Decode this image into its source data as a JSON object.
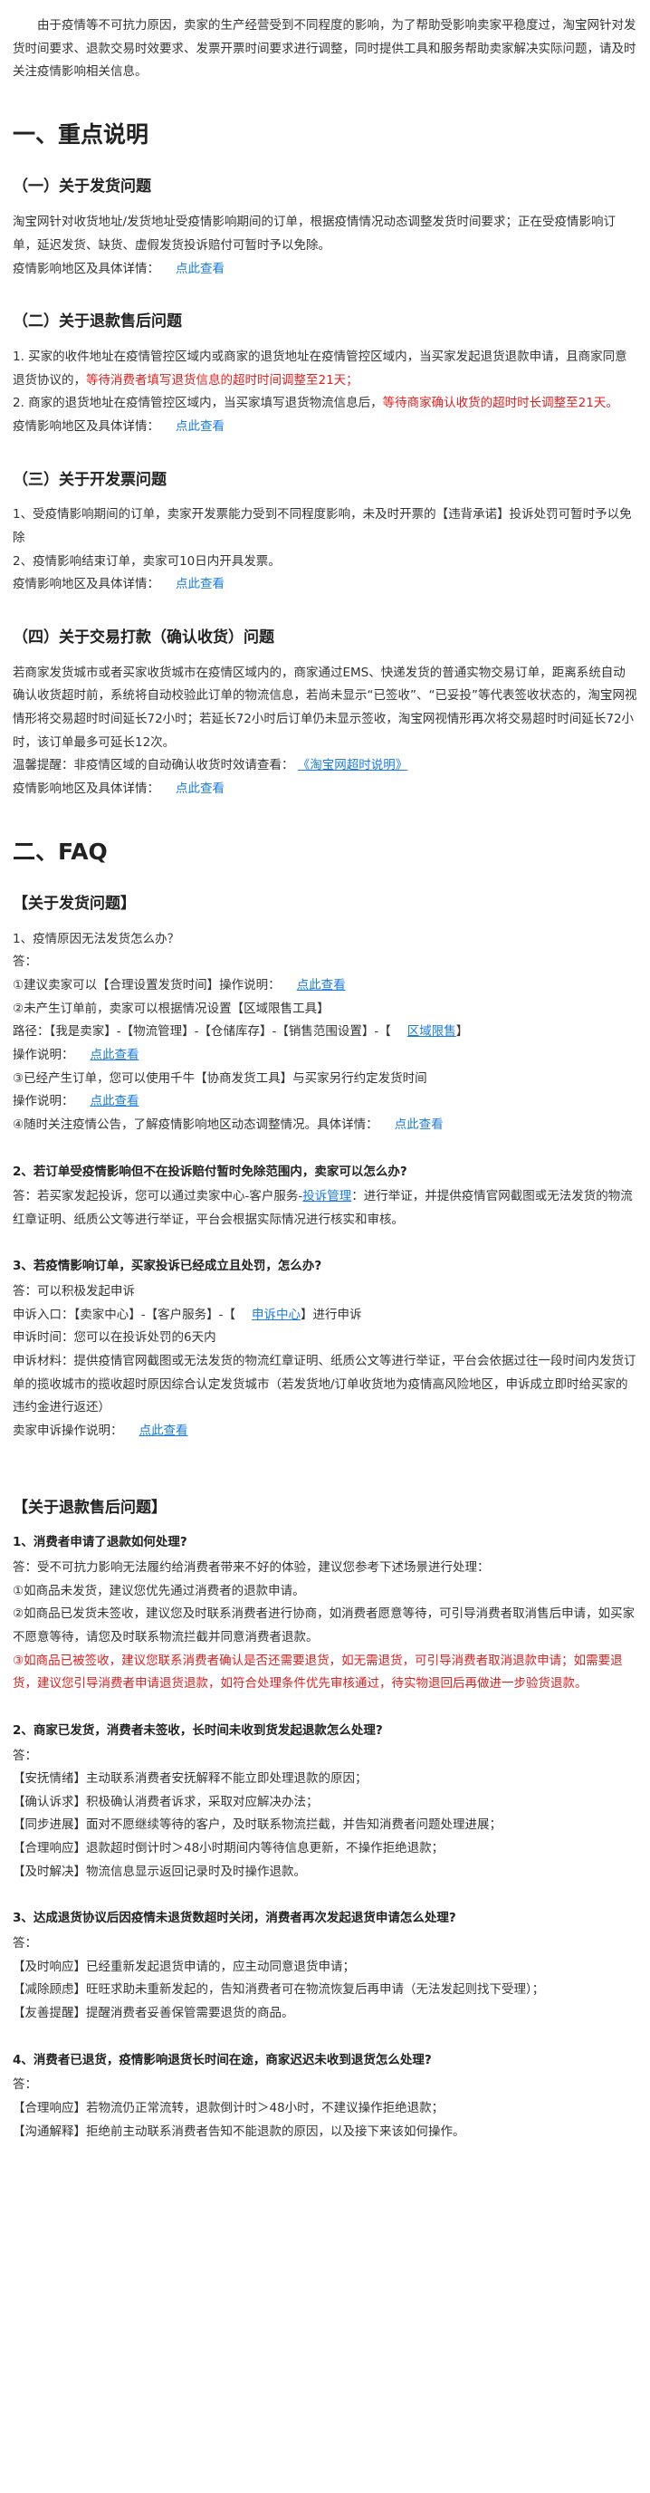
{
  "intro": "由于疫情等不可抗力原因，卖家的生产经营受到不同程度的影响，为了帮助受影响卖家平稳度过，淘宝网针对发货时间要求、退款交易时效要求、发票开票时间要求进行调整，同时提供工具和服务帮助卖家解决实际问题，请及时关注疫情影响相关信息。",
  "section1": {
    "title": "一、重点说明",
    "shipping": {
      "title": "（一）关于发货问题",
      "body": "淘宝网针对收货地址/发货地址受疫情影响期间的订单，根据疫情情况动态调整发货时间要求；正在受疫情影响订单，延迟发货、缺货、虚假发货投诉赔付可暂时予以免除。",
      "detail_label": "疫情影响地区及具体详情：",
      "link": "点此查看"
    },
    "refund": {
      "title": "（二）关于退款售后问题",
      "item1_pre": "1.    买家的收件地址在疫情管控区域内或商家的退货地址在疫情管控区域内，当买家发起退货退款申请，且商家同意退货协议的，",
      "item1_red": "等待消费者填写退货信息的超时时间调整至21天；",
      "item2_pre": "2.    商家的退货地址在疫情管控区域内，当买家填写退货物流信息后，",
      "item2_red": "等待商家确认收货的超时时长调整至21天。",
      "detail_label": "疫情影响地区及具体详情：",
      "link": "点此查看"
    },
    "invoice": {
      "title": "（三）关于开发票问题",
      "item1": "1、受疫情影响期间的订单，卖家开发票能力受到不同程度影响，未及时开票的【违背承诺】投诉处罚可暂时予以免除",
      "item2": "2、疫情影响结束订单，卖家可10日内开具发票。",
      "detail_label": "疫情影响地区及具体详情：",
      "link": "点此查看"
    },
    "payment": {
      "title": "（四）关于交易打款（确认收货）问题",
      "body": "若商家发货城市或者买家收货城市在疫情区域内的，商家通过EMS、快递发货的普通实物交易订单，距离系统自动确认收货超时前，系统将自动校验此订单的物流信息，若尚未显示“已签收”、“已妥投”等代表签收状态的，淘宝网视情形将交易超时时间延长72小时；若延长72小时后订单仍未显示签收，淘宝网视情形再次将交易超时时间延长72小时，该订单最多可延长12次。",
      "tip_label": "温馨提醒：非疫情区域的自动确认收货时效请查看：",
      "tip_link": "《淘宝网超时说明》",
      "detail_label": "疫情影响地区及具体详情：",
      "link": "点此查看"
    }
  },
  "section2": {
    "title": "二、FAQ",
    "group1": {
      "title": "【关于发货问题】",
      "q1": {
        "question": "1、疫情原因无法发货怎么办？",
        "answer_label": "答：",
        "line1_pre": "①建议卖家可以【合理设置发货时间】操作说明：",
        "line1_link": "点此查看",
        "line2": "②未产生订单前，卖家可以根据情况设置【区域限售工具】",
        "line3_pre": "路径：【我是卖家】-【物流管理】-【仓储库存】-【销售范围设置】-【",
        "line3_link": "区域限售",
        "line3_post": "】",
        "line4_pre": "操作说明：",
        "line4_link": "点此查看",
        "line5": "③已经产生订单，您可以使用千牛【协商发货工具】与买家另行约定发货时间",
        "line6_pre": "操作说明：",
        "line6_link": "点此查看",
        "line7_pre": "④随时关注疫情公告，了解疫情影响地区动态调整情况。具体详情：",
        "line7_link": "点此查看"
      },
      "q2": {
        "question": "2、若订单受疫情影响但不在投诉赔付暂时免除范围内，卖家可以怎么办?",
        "answer_pre": "答：若买家发起投诉，您可以通过卖家中心-客户服务-",
        "answer_link": "投诉管理",
        "answer_post": "：进行举证，并提供疫情官网截图或无法发货的物流红章证明、纸质公文等进行举证，平台会根据实际情况进行核实和审核。"
      },
      "q3": {
        "question": "3、若疫情影响订单，买家投诉已经成立且处罚，怎么办?",
        "line1": "答：可以积极发起申诉",
        "line2_pre": "申诉入口：【卖家中心】-【客户服务】-【",
        "line2_link": "申诉中心",
        "line2_post": "】进行申诉",
        "line3": "申诉时间：您可以在投诉处罚的6天内",
        "line4": "申诉材料：提供疫情官网截图或无法发货的物流红章证明、纸质公文等进行举证，平台会依据过往一段时间内发货订单的揽收城市的揽收超时原因综合认定发货城市（若发货地/订单收货地为疫情高风险地区，申诉成立即时给买家的违约金进行返还）",
        "line5_pre": "卖家申诉操作说明：",
        "line5_link": "点此查看"
      }
    },
    "group2": {
      "title": "【关于退款售后问题】",
      "q1": {
        "question": "1、消费者申请了退款如何处理?",
        "answer": "答：受不可抗力影响无法履约给消费者带来不好的体验，建议您参考下述场景进行处理：",
        "line1": "①如商品未发货，建议您优先通过消费者的退款申请。",
        "line2": "②如商品已发货未签收，建议您及时联系消费者进行协商，如消费者愿意等待，可引导消费者取消售后申请，如买家不愿意等待，请您及时联系物流拦截并同意消费者退款。",
        "line3_red": "③如商品已被签收，建议您联系消费者确认是否还需要退货，如无需退货，可引导消费者取消退款申请；如需要退货，建议您引导消费者申请退货退款，如符合处理条件优先审核通过，待实物退回后再做进一步验货退款。"
      },
      "q2": {
        "question": "2、商家已发货，消费者未签收，长时间未收到货发起退款怎么处理?",
        "answer_label": "答：",
        "line1": "【安抚情绪】主动联系消费者安抚解释不能立即处理退款的原因；",
        "line2": "【确认诉求】积极确认消费者诉求，采取对应解决办法；",
        "line3": "【同步进展】面对不愿继续等待的客户，及时联系物流拦截，并告知消费者问题处理进展；",
        "line4": "【合理响应】退款超时倒计时＞48小时期间内等待信息更新，不操作拒绝退款；",
        "line5": "【及时解决】物流信息显示返回记录时及时操作退款。"
      },
      "q3": {
        "question": "3、达成退货协议后因疫情未退货数超时关闭，消费者再次发起退货申请怎么处理?",
        "answer_label": "答：",
        "line1": "【及时响应】已经重新发起退货申请的，应主动同意退货申请；",
        "line2": "【减除顾虑】旺旺求助未重新发起的，告知消费者可在物流恢复后再申请（无法发起则找下受理）；",
        "line3": "【友善提醒】提醒消费者妥善保管需要退货的商品。"
      },
      "q4": {
        "question": "4、消费者已退货，疫情影响退货长时间在途，商家迟迟未收到退货怎么处理?",
        "answer_label": "答：",
        "line1": "【合理响应】若物流仍正常流转，退款倒计时＞48小时，不建议操作拒绝退款；",
        "line2": "【沟通解释】拒绝前主动联系消费者告知不能退款的原因，以及接下来该如何操作。"
      }
    }
  },
  "colors": {
    "link": "#1a7ce6",
    "warning": "#e02020",
    "text": "#333333"
  }
}
